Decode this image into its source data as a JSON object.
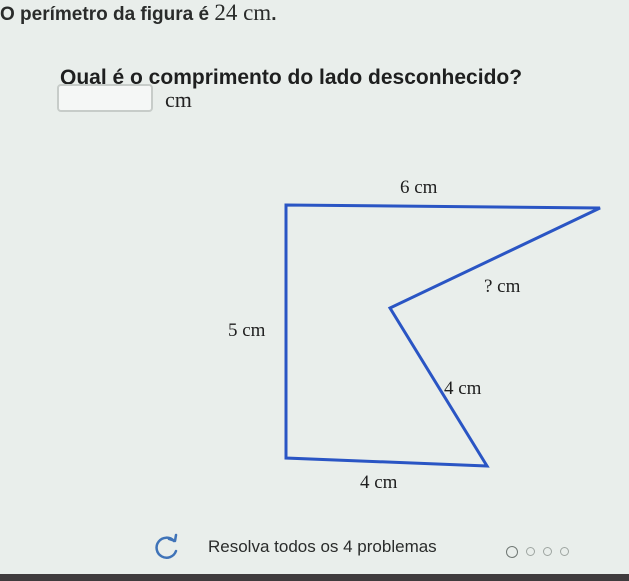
{
  "problem": {
    "intro": "O perímetro da figura é",
    "value": "24 cm",
    "end": "."
  },
  "question": {
    "title": "Qual é o comprimento do lado desconhecido?",
    "input_value": "",
    "unit": "cm"
  },
  "figure": {
    "labels": {
      "top": "6 cm",
      "unknown": "? cm",
      "left": "5 cm",
      "diagonal": "4 cm",
      "bottom": "4 cm"
    },
    "stroke_color": "#2a55c4"
  },
  "footer": {
    "text": "Resolva todos os 4 problemas",
    "icon": "retry-icon",
    "progress": {
      "current": 1,
      "total": 4
    }
  }
}
